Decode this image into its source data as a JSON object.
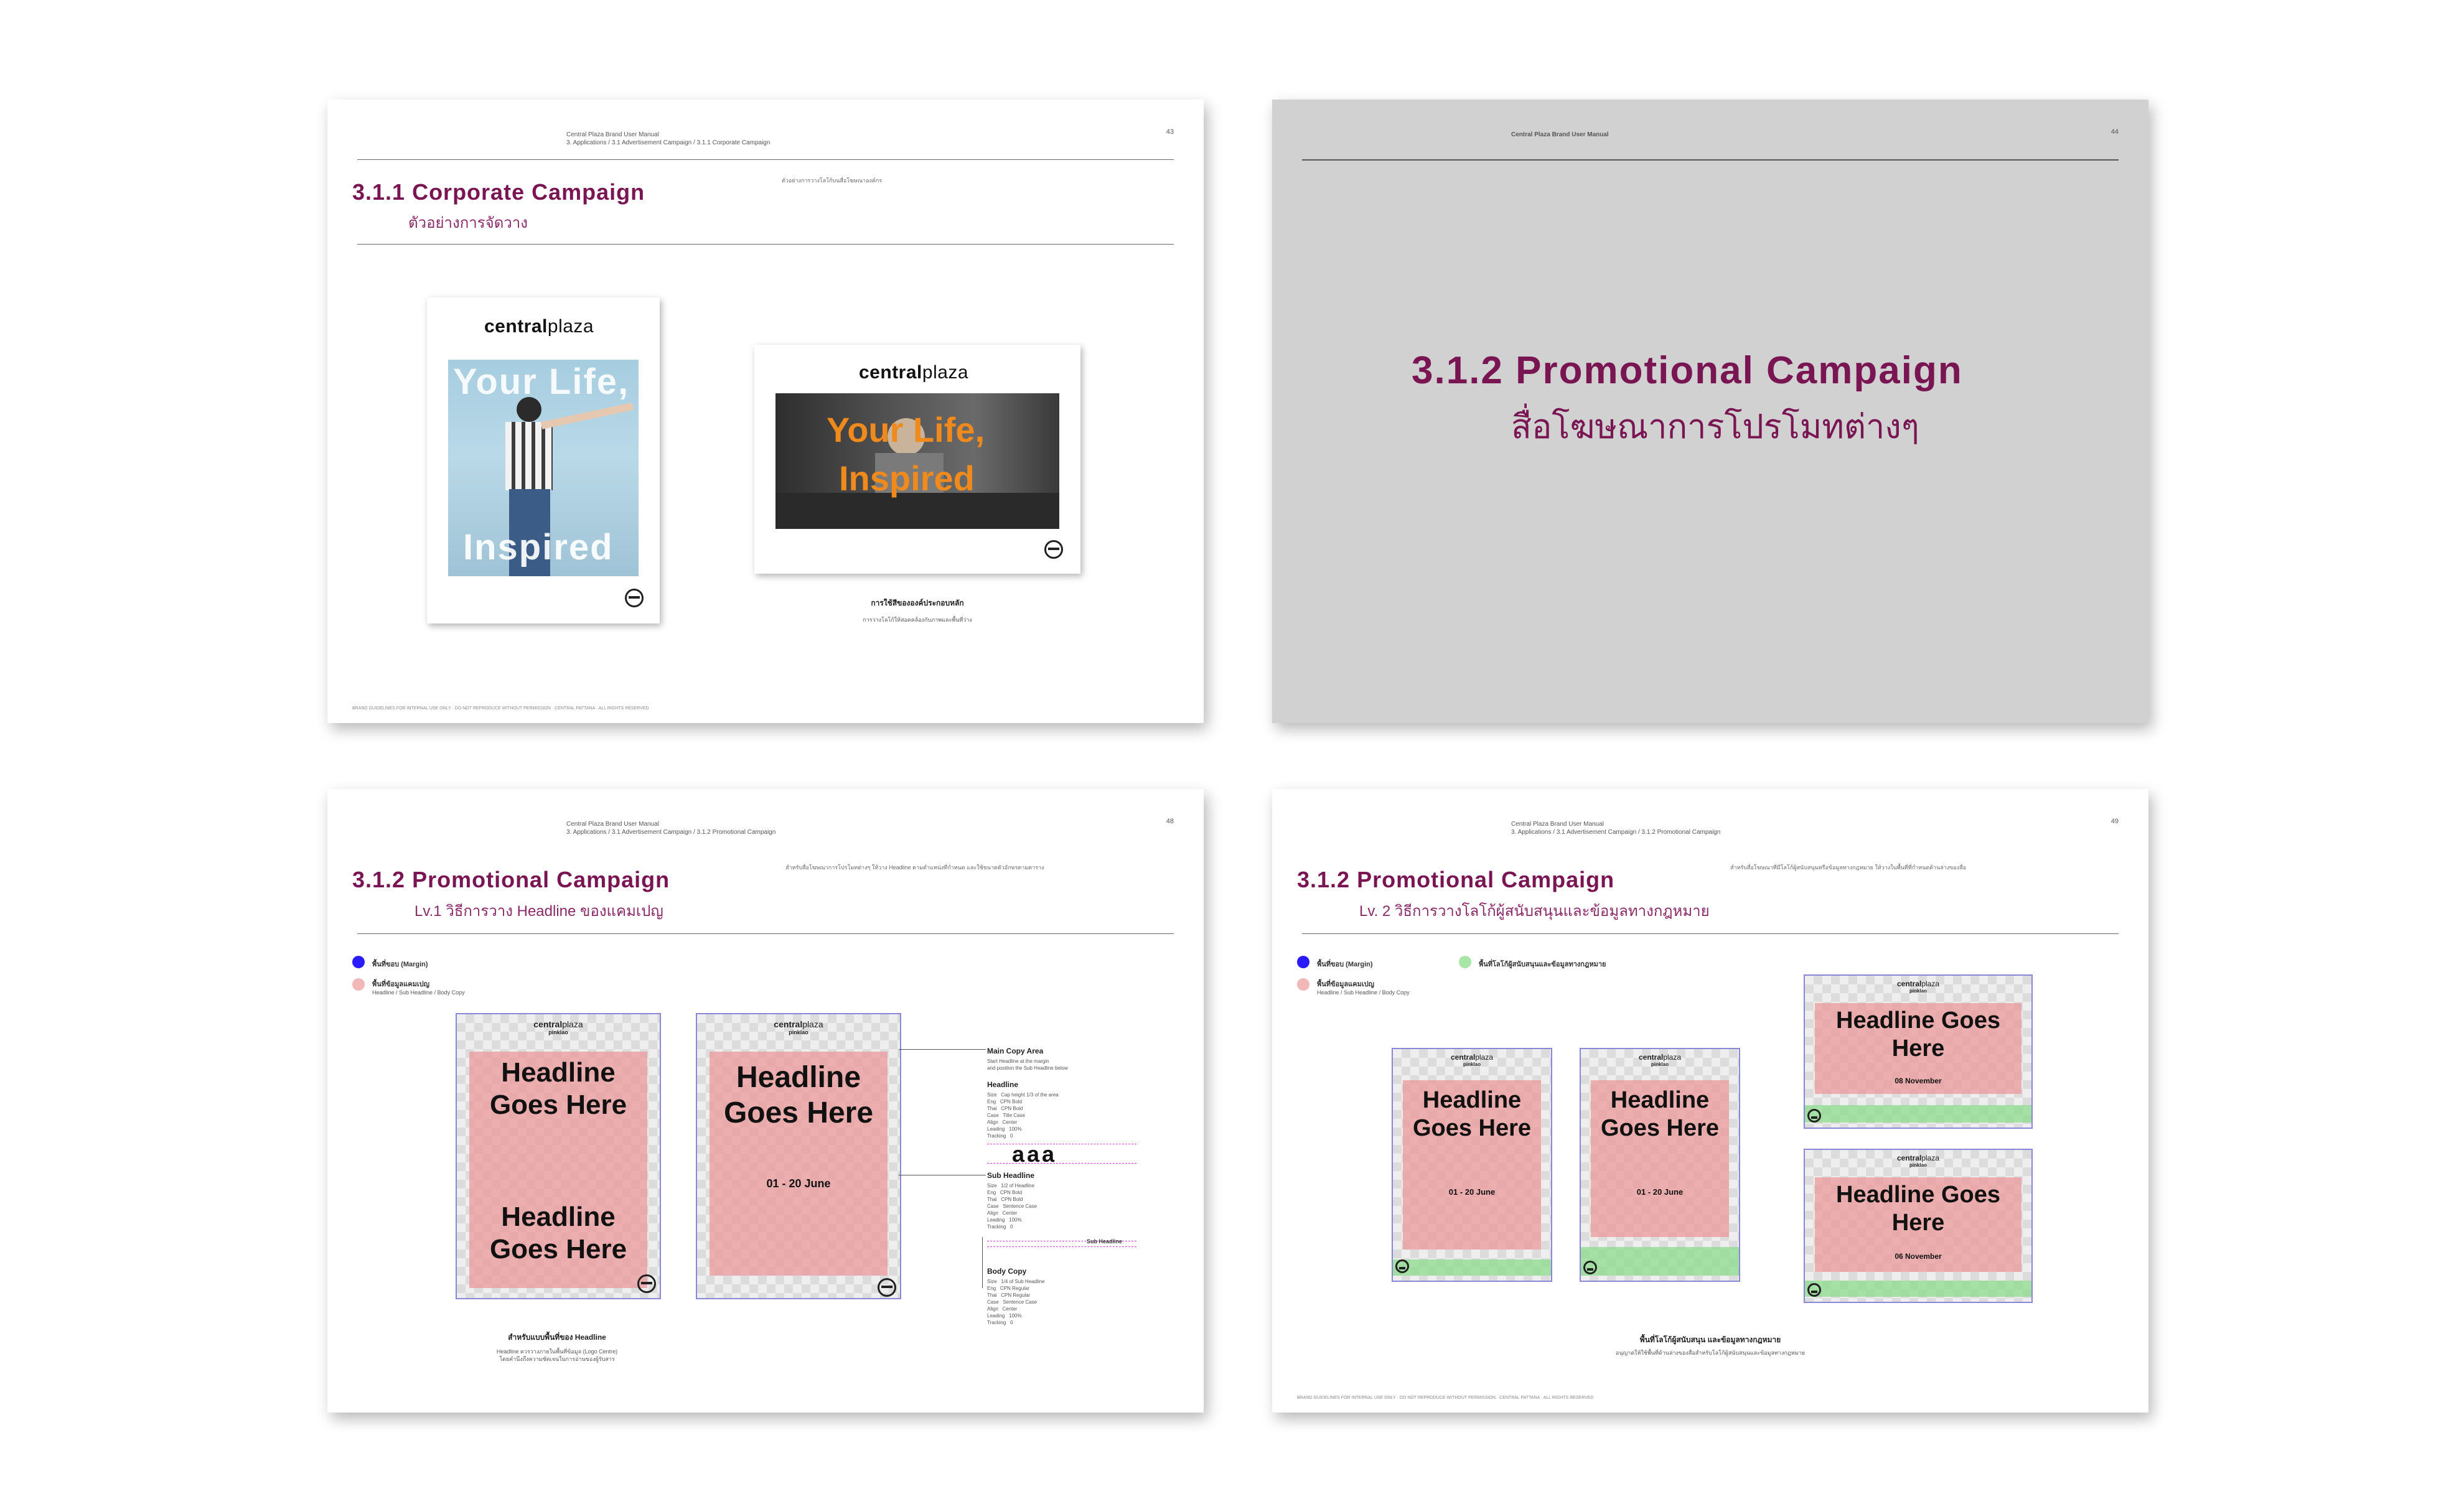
{
  "brand": {
    "logo_bold": "central",
    "logo_light": "plaza",
    "sub_brand": "pinklao",
    "accent": "#7a1553"
  },
  "page43": {
    "crumb1": "Central Plaza Brand User Manual",
    "crumb2": "3. Applications / 3.1 Advertisement Campaign / 3.1.1 Corporate Campaign",
    "page_number": "43",
    "title": "3.1.1 Corporate Campaign",
    "subtitle": "ตัวอย่างการจัดวาง",
    "note": "ตัวอย่างการวางโลโก้บนสื่อโฆษณาองค์กร",
    "poster_word1": "Your Life,",
    "poster_word2": "Inspired",
    "landscape_word1": "Your Life,",
    "landscape_word2": "Inspired",
    "caption_title": "การใช้สีขององค์ประกอบหลัก",
    "caption_text": "การวางโลโก้ให้สอดคล้องกับภาพและพื้นที่ว่าง",
    "footer": "BRAND GUIDELINES FOR INTERNAL USE ONLY · DO NOT REPRODUCE WITHOUT PERMISSION · CENTRAL PATTANA · ALL RIGHTS RESERVED"
  },
  "page44": {
    "crumb": "Central Plaza Brand User Manual",
    "page_number": "44",
    "title": "3.1.2 Promotional Campaign",
    "subtitle": "สื่อโฆษณาการโปรโมทต่างๆ"
  },
  "page48": {
    "crumb1": "Central Plaza Brand User Manual",
    "crumb2": "3. Applications / 3.1 Advertisement Campaign / 3.1.2 Promotional Campaign",
    "page_number": "48",
    "title": "3.1.2 Promotional Campaign",
    "subtitle": "Lv.1 วิธีการวาง Headline ของแคมเปญ",
    "note": "สำหรับสื่อโฆษณาการโปรโมทต่างๆ ให้วาง Headline ตามตำแหน่งที่กำหนด และใช้ขนาดตัวอักษรตามตาราง",
    "legend_margin": "พื้นที่ขอบ (Margin)",
    "legend_info": "พื้นที่ข้อมูลแคมเปญ",
    "legend_info_sub": "Headline / Sub Headline / Body Copy",
    "grid1_headline_top": "Headline Goes Here",
    "grid1_headline_bottom": "Headline Goes Here",
    "grid2_headline": "Headline Goes Here",
    "grid2_date": "01 - 20 June",
    "spec_main_title": "Main Copy Area",
    "spec_main_text": "Start Headline at the margin\nand position the Sub Headline below",
    "spec_headline_title": "Headline",
    "spec_headline_text": "Size   Cap height 1/3 of the area\nEng   CPN Bold\nThai   CPN Bold\nCase   Title Case\nAlign   Center\nLeading   100%\nTracking   0",
    "spec_sample": "aaa",
    "spec_sub_title": "Sub Headline",
    "spec_sub_text": "Size   1/2 of Headline\nEng   CPN Bold\nThai   CPN Bold\nCase   Sentence Case\nAlign   Center\nLeading   100%\nTracking   0",
    "spec_sub_label": "Sub Headline",
    "spec_body_title": "Body Copy",
    "spec_body_text": "Size   1/4 of Sub Headline\nEng   CPN Regular\nThai   CPN Regular\nCase   Sentence Case\nAlign   Center\nLeading   100%\nTracking   0",
    "caption_title": "สำหรับแบบพื้นที่ของ Headline",
    "caption_text": "Headline ควรวางภายในพื้นที่ข้อมูล (Logo Centre)\nโดยคำนึงถึงความชัดเจนในการอ่านของผู้รับสาร"
  },
  "page49": {
    "crumb1": "Central Plaza Brand User Manual",
    "crumb2": "3. Applications / 3.1 Advertisement Campaign / 3.1.2 Promotional Campaign",
    "page_number": "49",
    "title": "3.1.2 Promotional Campaign",
    "subtitle": "Lv. 2 วิธีการวางโลโก้ผู้สนับสนุนและข้อมูลทางกฎหมาย",
    "note": "สำหรับสื่อโฆษณาที่มีโลโก้ผู้สนับสนุนหรือข้อมูลทางกฎหมาย ให้วางในพื้นที่ที่กำหนดด้านล่างของสื่อ",
    "legend_margin": "พื้นที่ขอบ (Margin)",
    "legend_sponsor": "พื้นที่โลโก้ผู้สนับสนุนและข้อมูลทางกฎหมาย",
    "legend_info": "พื้นที่ข้อมูลแคมเปญ",
    "legend_info_sub": "Headline / Sub Headline / Body Copy",
    "grid_a_headline": "Headline Goes Here",
    "grid_a_date": "01 - 20 June",
    "grid_b_headline": "Headline Goes Here",
    "grid_b_date": "01 - 20 June",
    "grid_c_headline": "Headline Goes Here",
    "grid_c_date": "08 November",
    "grid_d_headline": "Headline Goes Here",
    "grid_d_date": "06 November",
    "caption_title": "พื้นที่โลโก้ผู้สนับสนุน และข้อมูลทางกฎหมาย",
    "caption_text": "อนุญาตให้ใช้พื้นที่ด้านล่างของสื่อสำหรับโลโก้ผู้สนับสนุนและข้อมูลทางกฎหมาย",
    "footer": "BRAND GUIDELINES FOR INTERNAL USE ONLY · DO NOT REPRODUCE WITHOUT PERMISSION · CENTRAL PATTANA · ALL RIGHTS RESERVED"
  },
  "colors": {
    "title": "#7a1553",
    "margin_blue": "#2a1aff",
    "info_pink": "#f2b8b8",
    "sponsor_green": "#a8e6a8",
    "orange_copy": "#f08a1c",
    "page_gray": "#d1d1d1"
  }
}
